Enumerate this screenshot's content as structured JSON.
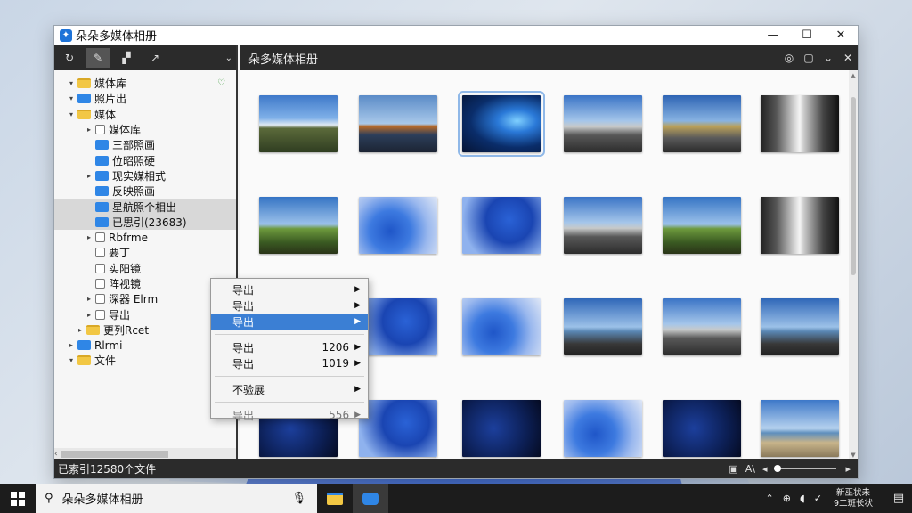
{
  "window": {
    "title": "朵朵多媒体相册",
    "app_icon": "app-logo-icon",
    "controls": [
      "—",
      "☐",
      "✕"
    ]
  },
  "left_toolbar": {
    "buttons": [
      "↻",
      "✎",
      "▞",
      "↗"
    ],
    "dropdown": "⌄"
  },
  "tree": [
    {
      "label": "媒体库",
      "twisty": "▾",
      "icon": "folder",
      "pinned": true
    },
    {
      "label": "照片出",
      "twisty": "▾",
      "icon": "blue"
    },
    {
      "label": "媒体",
      "twisty": "▾",
      "icon": "folder"
    },
    {
      "label": "媒体库",
      "twisty": "▸",
      "icon": "doc",
      "indent": 1
    },
    {
      "label": "三部照画",
      "twisty": "",
      "icon": "blue",
      "indent": 1
    },
    {
      "label": "位昭照硬",
      "twisty": "",
      "icon": "blue",
      "indent": 1
    },
    {
      "label": "现实媒相式",
      "twisty": "▸",
      "icon": "blue",
      "indent": 1
    },
    {
      "label": "反映照画",
      "twisty": "",
      "icon": "blue",
      "indent": 1
    },
    {
      "label": "星航照个相出",
      "twisty": "",
      "icon": "blue",
      "indent": 1,
      "selected": true
    },
    {
      "label": "已思引(23683)",
      "twisty": "",
      "icon": "blue",
      "indent": 1,
      "selected": true
    },
    {
      "label": "Rbfrme",
      "twisty": "▸",
      "icon": "doc",
      "indent": 1
    },
    {
      "label": "要丁",
      "twisty": "",
      "icon": "doc",
      "indent": 1
    },
    {
      "label": "实阳镜",
      "twisty": "",
      "icon": "doc",
      "indent": 1
    },
    {
      "label": "阵视镜",
      "twisty": "",
      "icon": "doc",
      "indent": 1
    },
    {
      "label": "深器 Elrm",
      "twisty": "▸",
      "icon": "doc",
      "indent": 1
    },
    {
      "label": "导出",
      "twisty": "▸",
      "icon": "doc",
      "indent": 1
    },
    {
      "label": "更列Rcet",
      "twisty": "▸",
      "icon": "folder",
      "indent": 0.5
    },
    {
      "label": "Rlrmi",
      "twisty": "▸",
      "icon": "blue"
    },
    {
      "label": "文件",
      "twisty": "▾",
      "icon": "folder"
    }
  ],
  "right_header": {
    "title": "朵多媒体相册",
    "buttons": [
      "◎",
      "▢",
      "⌄",
      "✕"
    ]
  },
  "thumbnails": [
    {
      "style": "t-field"
    },
    {
      "style": "t-tree"
    },
    {
      "style": "t-win",
      "selected": true
    },
    {
      "style": "t-road"
    },
    {
      "style": "t-road2"
    },
    {
      "style": "t-hall"
    },
    {
      "style": "t-green"
    },
    {
      "style": "t-swirl"
    },
    {
      "style": "t-swirl2"
    },
    {
      "style": "t-road"
    },
    {
      "style": "t-green"
    },
    {
      "style": "t-hall"
    },
    {
      "style": "t-swirl"
    },
    {
      "style": "t-swirl2"
    },
    {
      "style": "t-swirl"
    },
    {
      "style": "t-sea"
    },
    {
      "style": "t-road"
    },
    {
      "style": "t-sea"
    },
    {
      "style": "t-dark"
    },
    {
      "style": "t-swirl2"
    },
    {
      "style": "t-dark"
    },
    {
      "style": "t-swirl"
    },
    {
      "style": "t-dark"
    },
    {
      "style": "t-beach"
    }
  ],
  "status": {
    "text": "已索引12580个文件",
    "buttons": [
      "▣",
      "A\\",
      "◂",
      "▸"
    ]
  },
  "context_menu": {
    "items": [
      {
        "label": "导出",
        "value": "",
        "hl": false
      },
      {
        "label": "导出",
        "value": "",
        "hl": false
      },
      {
        "label": "导出",
        "value": "",
        "hl": true
      },
      {
        "sep": true
      },
      {
        "label": "导出",
        "value": "1206",
        "hl": false
      },
      {
        "label": "导出",
        "value": "1019",
        "hl": false
      },
      {
        "sep": true
      },
      {
        "label": "不验展",
        "value": "",
        "hl": false
      },
      {
        "sep": true
      },
      {
        "label": "导出",
        "value": "556",
        "hl": false,
        "dim": true
      }
    ]
  },
  "taskbar": {
    "search_text": "朵朵多媒体相册",
    "clock_time": "新巫状未",
    "clock_date": "9二斑长状",
    "tray_icons": [
      "⌃",
      "⊕",
      "◖",
      "✓"
    ],
    "notification": "▤"
  }
}
